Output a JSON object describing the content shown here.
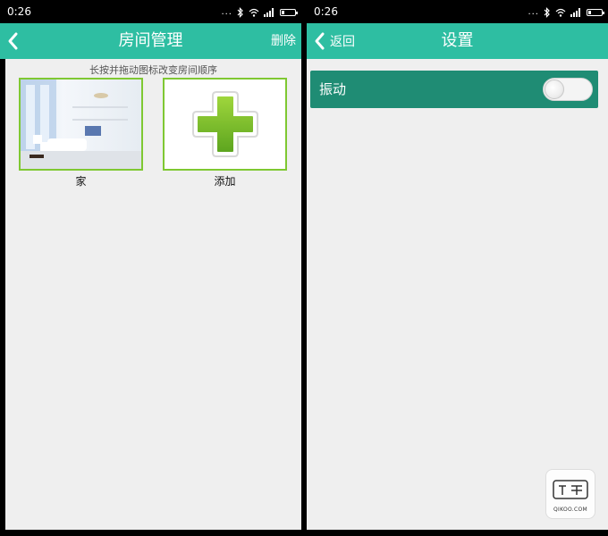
{
  "left_screen": {
    "status": {
      "time": "0:26",
      "dots": "..."
    },
    "appbar": {
      "title": "房间管理",
      "action": "删除"
    },
    "hint": "长按并拖动图标改变房间顺序",
    "rooms": [
      {
        "label": "家"
      },
      {
        "label": "添加"
      }
    ]
  },
  "right_screen": {
    "status": {
      "time": "0:26",
      "dots": "..."
    },
    "appbar": {
      "title": "设置",
      "back_label": "返回"
    },
    "settings": [
      {
        "label": "振动",
        "enabled": false
      }
    ]
  },
  "colors": {
    "appbar": "#2ebea2",
    "setting_row": "#1f8c74",
    "tile_border": "#7fc832",
    "content_bg": "#efefef"
  },
  "icons": {
    "back": "chevron-left-icon",
    "add": "plus-icon",
    "status": [
      "bluetooth-icon",
      "wifi-icon",
      "signal-icon",
      "battery-icon"
    ]
  }
}
